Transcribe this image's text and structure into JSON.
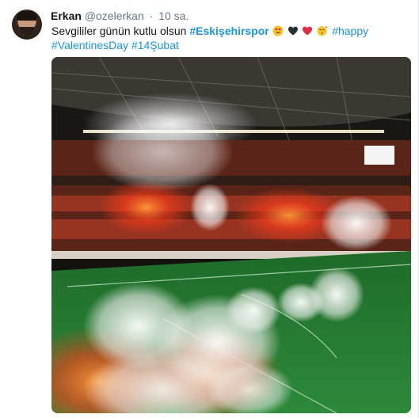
{
  "tweet": {
    "author_name": "Erkan",
    "author_handle": "@ozelerkan",
    "separator": "·",
    "timestamp": "10 sa.",
    "text_before": "Sevgililer günün kutlu olsun",
    "hashtags": {
      "eskisehirspor": "#Eskişehirspor",
      "happy": "#happy",
      "valentines_day": "#ValentinesDay",
      "14subat": "#14Şubat"
    },
    "emojis": [
      "heart-eyes-icon",
      "black-heart-icon",
      "red-heart-icon",
      "kiss-face-icon"
    ]
  },
  "colors": {
    "link": "#1b95e0",
    "text": "#14171a",
    "muted": "#657786"
  }
}
